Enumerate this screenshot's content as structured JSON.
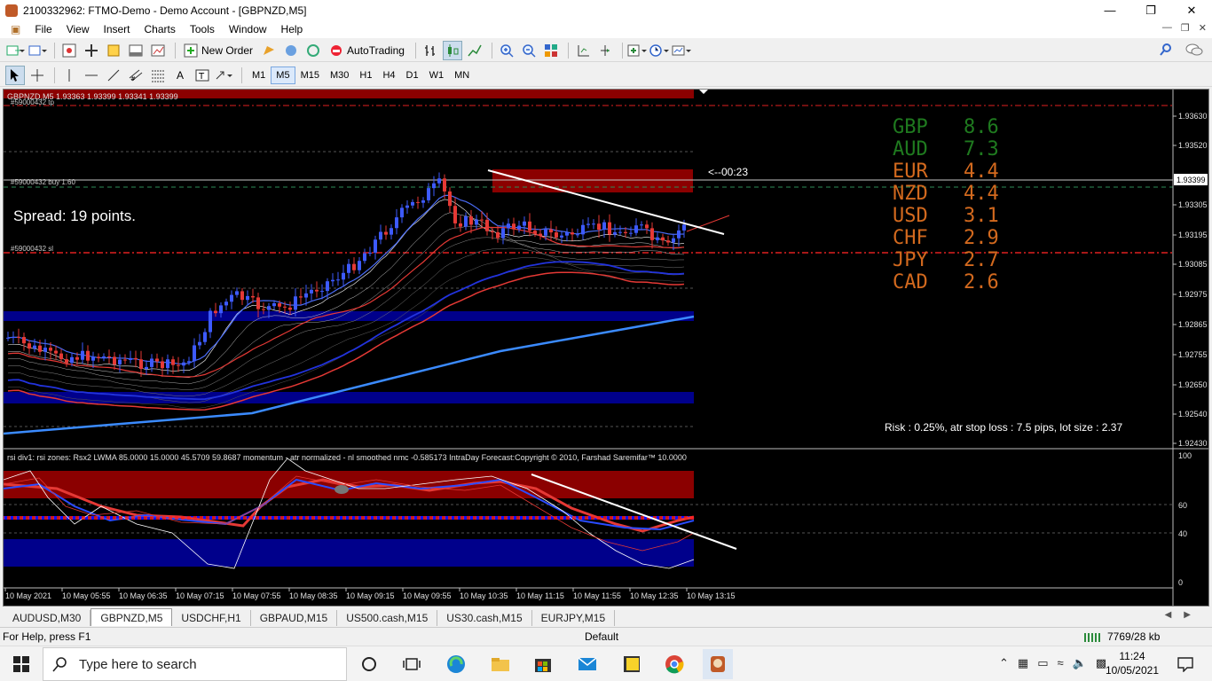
{
  "window": {
    "title": "2100332962: FTMO-Demo - Demo Account - [GBPNZD,M5]"
  },
  "menu": [
    "File",
    "View",
    "Insert",
    "Charts",
    "Tools",
    "Window",
    "Help"
  ],
  "toolbar": {
    "new_order": "New Order",
    "autotrading": "AutoTrading"
  },
  "timeframes": [
    "M1",
    "M5",
    "M15",
    "M30",
    "H1",
    "H4",
    "D1",
    "W1",
    "MN"
  ],
  "active_timeframe": "M5",
  "chart": {
    "header": "GBPNZD,M5  1.93363 1.93399 1.93341 1.93399",
    "order_tp": "#59000432 tp",
    "order_buy": "#59000432 buy 1.60",
    "order_sl": "#59000432 sl",
    "countdown": "<--00:23",
    "spread": "Spread: 19 points.",
    "risk": "Risk : 0.25%, atr stop loss : 7.5 pips, lot size : 2.37",
    "current_price": "1.93399",
    "price_axis": [
      "1.93630",
      "1.93520",
      "1.93305",
      "1.93195",
      "1.93085",
      "1.92975",
      "1.92865",
      "1.92755",
      "1.92650",
      "1.92540",
      "1.92430"
    ],
    "strength": [
      {
        "cur": "GBP",
        "val": "8.6",
        "color": "#1f7a1f"
      },
      {
        "cur": "AUD",
        "val": "7.3",
        "color": "#1f7a1f"
      },
      {
        "cur": "EUR",
        "val": "4.4",
        "color": "#d2691e"
      },
      {
        "cur": "NZD",
        "val": "4.4",
        "color": "#d2691e"
      },
      {
        "cur": "USD",
        "val": "3.1",
        "color": "#d2691e"
      },
      {
        "cur": "CHF",
        "val": "2.9",
        "color": "#d2691e"
      },
      {
        "cur": "JPY",
        "val": "2.7",
        "color": "#d2691e"
      },
      {
        "cur": "CAD",
        "val": "2.6",
        "color": "#d2691e"
      }
    ],
    "indicator_header": "rsi div1: rsi zones: Rsx2 LWMA 85.0000 15.0000 45.5709 59.8687  momentum - atr normalized - nl smoothed nmc -0.585173  IntraDay Forecast:Copyright © 2010, Farshad Saremifar™  10.0000",
    "ind_axis": [
      "100",
      "60",
      "40",
      "0"
    ],
    "time_axis": [
      "10 May 2021",
      "10 May 05:55",
      "10 May 06:35",
      "10 May 07:15",
      "10 May 07:55",
      "10 May 08:35",
      "10 May 09:15",
      "10 May 09:55",
      "10 May 10:35",
      "10 May 11:15",
      "10 May 11:55",
      "10 May 12:35",
      "10 May 13:15"
    ]
  },
  "tabs": [
    "AUDUSD,M30",
    "GBPNZD,M5",
    "USDCHF,H1",
    "GBPAUD,M15",
    "US500.cash,M15",
    "US30.cash,M15",
    "EURJPY,M15"
  ],
  "active_tab": "GBPNZD,M5",
  "status": {
    "help": "For Help, press F1",
    "profile": "Default",
    "traffic": "7769/28 kb"
  },
  "taskbar": {
    "search_placeholder": "Type here to search",
    "time": "11:24",
    "date": "10/05/2021"
  }
}
